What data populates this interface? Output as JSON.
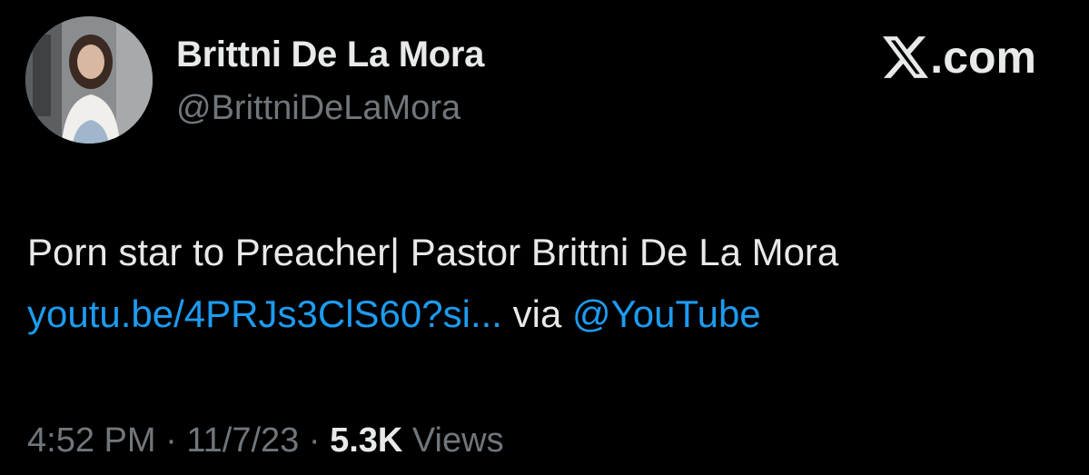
{
  "author": {
    "display_name": "Brittni De La Mora",
    "handle": "@BrittniDeLaMora",
    "avatar": "profile-photo"
  },
  "brand": {
    "label": ".com",
    "icon": "x-logo-icon"
  },
  "tweet": {
    "text_line1": "Porn star to Preacher| Pastor Brittni De La Mora",
    "link_text": "youtu.be/4PRJs3ClS60?si...",
    "via_text": " via ",
    "mention": "@YouTube"
  },
  "meta": {
    "time": "4:52 PM",
    "separator1": " · ",
    "date": "11/7/23",
    "separator2": " · ",
    "views_count": "5.3K",
    "views_label": " Views"
  },
  "colors": {
    "background": "#000000",
    "primary_text": "#e7e9ea",
    "secondary_text": "#71767b",
    "link": "#1d9bf0"
  }
}
